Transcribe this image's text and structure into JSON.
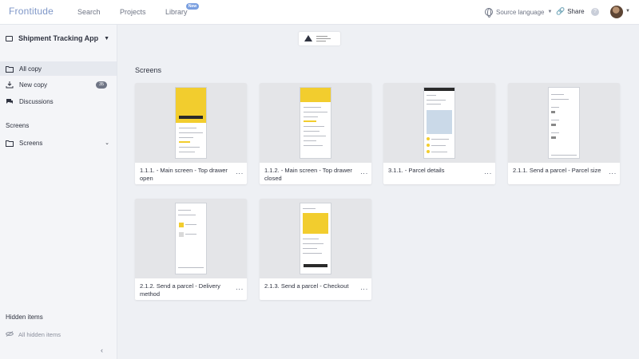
{
  "app": {
    "logo": "Frontitude"
  },
  "nav": {
    "search": "Search",
    "projects": "Projects",
    "library": "Library",
    "library_badge": "New"
  },
  "toolbar": {
    "source_language": "Source language",
    "share": "Share"
  },
  "sidebar": {
    "project_name": "Shipment Tracking App",
    "items": [
      {
        "label": "All copy",
        "icon": "folder-icon"
      },
      {
        "label": "New copy",
        "icon": "download-icon",
        "count": "35"
      },
      {
        "label": "Discussions",
        "icon": "chat-icon"
      }
    ],
    "screens_heading": "Screens",
    "screens_item": "Screens",
    "hidden_items_title": "Hidden items",
    "hidden_items_link": "All hidden items",
    "collapse_icon": "chevron-left-icon"
  },
  "main": {
    "section_title": "Screens",
    "cards": [
      {
        "title": "1.1.1. - Main screen - Top drawer open"
      },
      {
        "title": "1.1.2. - Main screen - Top drawer closed"
      },
      {
        "title": "3.1.1. - Parcel details"
      },
      {
        "title": "2.1.1. Send a parcel - Parcel size"
      },
      {
        "title": "2.1.2. Send a parcel - Delivery method"
      },
      {
        "title": "2.1.3. Send a parcel - Checkout"
      }
    ]
  },
  "colors": {
    "accent": "#7f97c8",
    "badge": "#7a9fe0",
    "thumb_yellow": "#f2cd2e",
    "background": "#eef0f4"
  }
}
